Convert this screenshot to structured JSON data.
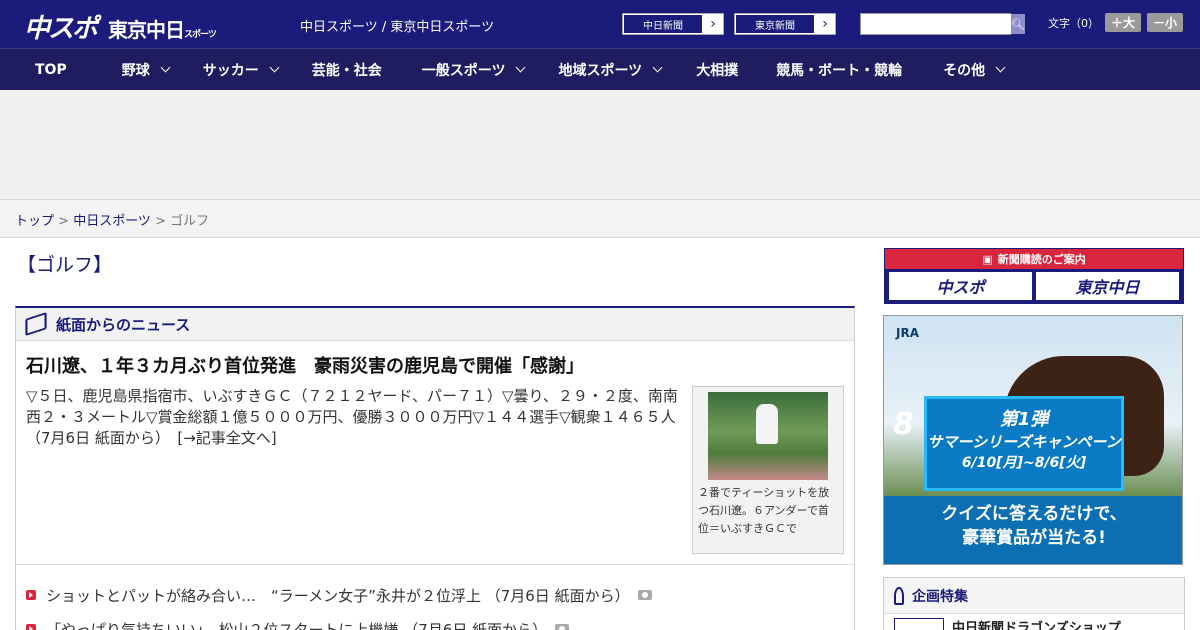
{
  "header": {
    "logo_main": "中スポ",
    "logo_sub": "東京中日",
    "logo_sub_small": "スポーツ",
    "tagline": "中日スポーツ / 東京中日スポーツ",
    "ext_links": [
      "中日新聞",
      "東京新聞"
    ],
    "search_placeholder": "",
    "font_label": "文字（0）",
    "font_up": "＋大",
    "font_down": "－小"
  },
  "nav": [
    {
      "label": "TOP",
      "chevron": false
    },
    {
      "label": "野球",
      "chevron": true
    },
    {
      "label": "サッカー",
      "chevron": true
    },
    {
      "label": "芸能・社会",
      "chevron": false
    },
    {
      "label": "一般スポーツ",
      "chevron": true
    },
    {
      "label": "地域スポーツ",
      "chevron": true
    },
    {
      "label": "大相撲",
      "chevron": false
    },
    {
      "label": "競馬・ボート・競輪",
      "chevron": false
    },
    {
      "label": "その他",
      "chevron": true
    }
  ],
  "breadcrumb": {
    "home": "トップ",
    "section": "中日スポーツ",
    "current": "ゴルフ",
    "sep": " > "
  },
  "page_title": "【ゴルフ】",
  "news": {
    "heading": "紙面からのニュース",
    "title": "石川遼、１年３カ月ぶり首位発進　豪雨災害の鹿児島で開催「感謝」",
    "body": "▽５日、鹿児島県指宿市、いぶすきＧＣ（７２１２ヤード、パー７１）▽曇り、２９・２度、南南西２・３メートル▽賞金総額１億５０００万円、優勝３０００万円▽１４４選手▽観衆１４６５人（7月6日 紙面から）　[→記事全文へ]",
    "photo_caption": "２番でティーショットを放つ石川遼。６アンダーで首位＝いぶすきＧＣで",
    "list": [
      "ショットとパットが絡み合い…　“ラーメン女子”永井が２位浮上 （7月6日 紙面から）",
      "「やっぱり気持ちいい」　松山２位スタートに上機嫌 （7月6日 紙面から）"
    ]
  },
  "sidebar": {
    "subscribe_label": "新聞購読のご案内",
    "sub_buttons": [
      "中スポ",
      "東京中日"
    ],
    "jra": {
      "logo": "JRA",
      "badge_num": "8",
      "campaign_line1": "第1弾",
      "campaign_line2": "サマーシリーズキャンペーン",
      "campaign_dates": "6/10[月]~8/6[火]",
      "bottom_line1": "クイズに答えるだけで、",
      "bottom_line2": "豪華賞品が当たる!"
    },
    "feature_heading": "企画特集",
    "feature_item": "中日新聞ドラゴンズショップ"
  }
}
